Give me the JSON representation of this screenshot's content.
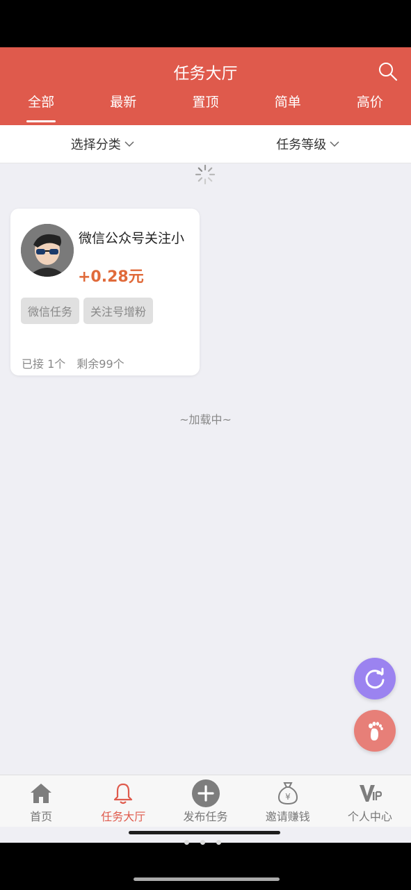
{
  "header": {
    "title": "任务大厅",
    "tabs": [
      {
        "label": "全部",
        "active": true
      },
      {
        "label": "最新"
      },
      {
        "label": "置顶"
      },
      {
        "label": "简单"
      },
      {
        "label": "高价"
      }
    ]
  },
  "filters": {
    "category": "选择分类",
    "level": "任务等级"
  },
  "task": {
    "title": "微信公众号关注小",
    "price": "+0.28元",
    "tags": [
      "微信任务",
      "关注号增粉"
    ],
    "accepted": "已接 1个",
    "remaining": "剩余99个"
  },
  "loading_text": "~加载中~",
  "bottom_nav": [
    {
      "label": "首页",
      "icon": "home-icon"
    },
    {
      "label": "任务大厅",
      "icon": "bell-icon",
      "active": true
    },
    {
      "label": "发布任务",
      "icon": "plus-icon"
    },
    {
      "label": "邀请赚钱",
      "icon": "money-bag-icon"
    },
    {
      "label": "个人中心",
      "icon": "vip-icon"
    }
  ],
  "colors": {
    "header": "#df5a4c",
    "price": "#e06a3a",
    "refresh_fab": "#9b83f0",
    "footprint_fab": "#e77f78"
  }
}
